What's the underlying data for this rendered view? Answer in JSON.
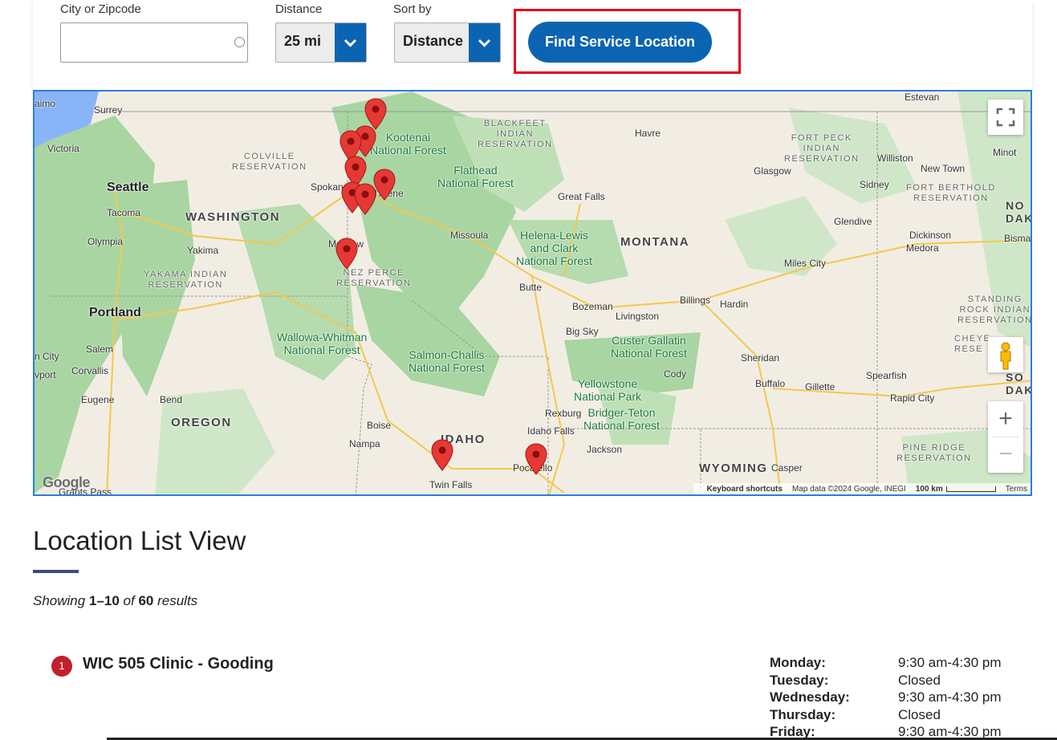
{
  "search": {
    "city_label": "City or Zipcode",
    "city_value": "",
    "city_placeholder": "",
    "distance_label": "Distance",
    "distance_value": "25 mi",
    "sort_label": "Sort by",
    "sort_value": "Distance",
    "find_button": "Find Service Location"
  },
  "map": {
    "labels": {
      "surrey": "Surrey",
      "victoria": "Victoria",
      "seattle": "Seattle",
      "tacoma": "Tacoma",
      "olympia": "Olympia",
      "washington": "WASHINGTON",
      "yakima": "Yakima",
      "yakama": "YAKAMA INDIAN\nRESERVATION",
      "portland": "Portland",
      "salem": "Salem",
      "corvallis": "Corvallis",
      "eugene": "Eugene",
      "bend": "Bend",
      "oregon": "OREGON",
      "colville": "COLVILLE\nRESERVATION",
      "spokane": "Spokan",
      "coeur": "d'Alene",
      "kootenai": "Kootenai\nNational Forest",
      "flathead": "Flathead\nNational Forest",
      "blackfeet": "BLACKFEET\nINDIAN\nRESERVATION",
      "havre": "Havre",
      "great_falls": "Great Falls",
      "missoula": "Missoula",
      "helena": "Helena-Lewis\nand Clark\nNational Forest",
      "montana": "MONTANA",
      "nezperce": "NEZ PERCE\nRESERVATION",
      "moscow": "Moscow",
      "butte": "Butte",
      "bozeman": "Bozeman",
      "livingston": "Livingston",
      "bigsky": "Big Sky",
      "billings": "Billings",
      "hardin": "Hardin",
      "custer": "Custer Gallatin\nNational Forest",
      "wallowa": "Wallowa-Whitman\nNational Forest",
      "salmon": "Salmon-Challis\nNational Forest",
      "yellowstone": "Yellowstone\nNational Park",
      "bridger": "Bridger-Teton\nNational Forest",
      "rexburg": "Rexburg",
      "idaho_falls": "Idaho Falls",
      "jackson": "Jackson",
      "cody": "Cody",
      "sheridan": "Sheridan",
      "buffalo": "Buffalo",
      "gillette": "Gillette",
      "spearfish": "Spearfish",
      "rapid": "Rapid City",
      "wyoming": "WYOMING",
      "casper": "Casper",
      "boise": "Boise",
      "nampa": "Nampa",
      "idaho": "IDAHO",
      "twin": "Twin Falls",
      "pocatello": "Pocatello",
      "estevan": "Estevan",
      "fortpeck": "FORT PECK\nINDIAN\nRESERVATION",
      "glasgow": "Glasgow",
      "williston": "Williston",
      "newtown": "New Town",
      "minot": "Minot",
      "sidney": "Sidney",
      "fortberthold": "FORT BERTHOLD\nRESERVATION",
      "glendive": "Glendive",
      "dickinson": "Dickinson",
      "medora": "Medora",
      "bismarck": "Bismarck",
      "miles": "Miles City",
      "standing": "STANDING\nROCK INDIAN\nRESERVATION",
      "pineridge": "PINE RIDGE\nRESERVATION",
      "nanaimo": "aimo",
      "oregoncity": "n City",
      "newport": "vport",
      "nod": "NO\nDAK",
      "sod": "SO\nDAK",
      "cheyenne": "CHEYE\nRESE",
      "grants": "Grants Pass"
    },
    "logo": "Google",
    "attribution": {
      "shortcuts": "Keyboard shortcuts",
      "data": "Map data ©2024 Google, INEGI",
      "scale": "100 km",
      "terms": "Terms"
    },
    "controls": {
      "zoom_in": "+",
      "zoom_out": "−"
    }
  },
  "list": {
    "title": "Location List View",
    "showing_word": "Showing",
    "range": "1–10",
    "of_word": "of",
    "total": "60",
    "results_word": "results"
  },
  "location": {
    "number": "1",
    "name": "WIC 505 Clinic - Gooding",
    "hours": [
      {
        "day": "Monday:",
        "time": "9:30 am-4:30 pm"
      },
      {
        "day": "Tuesday:",
        "time": "Closed"
      },
      {
        "day": "Wednesday:",
        "time": "9:30 am-4:30 pm"
      },
      {
        "day": "Thursday:",
        "time": "Closed"
      },
      {
        "day": "Friday:",
        "time": "9:30 am-4:30 pm"
      }
    ]
  },
  "colors": {
    "accent": "#0b64b1",
    "highlight": "#e3001b",
    "pin": "#e53935",
    "badge": "#c3202e",
    "forest": "#a8d5a2",
    "water": "#8ab4f8"
  }
}
